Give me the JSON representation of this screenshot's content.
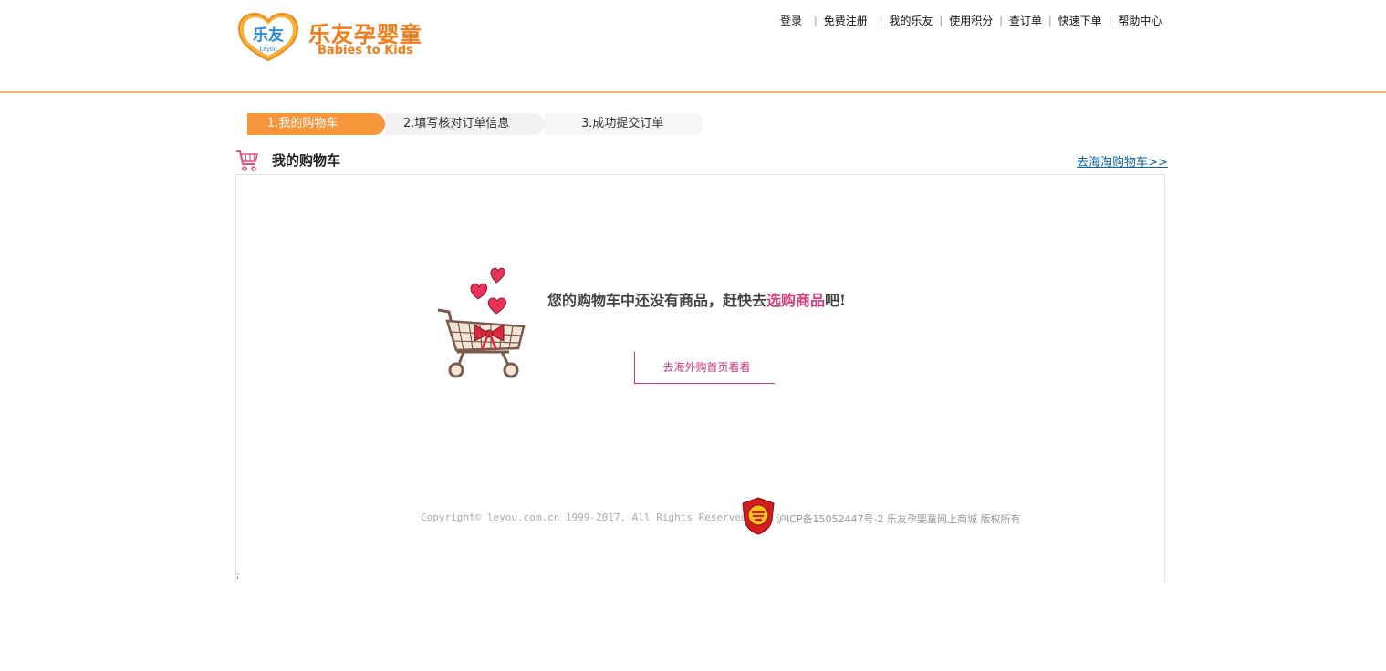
{
  "header": {
    "logo_cn": "乐友孕婴童",
    "logo_en": "Babies to Kids",
    "logo_badge": "乐友",
    "logo_badge_sub": "Leyou",
    "nav": [
      "登录",
      "免费注册",
      "我的乐友",
      "使用积分",
      "查订单",
      "快速下单",
      "帮助中心"
    ],
    "accent_color": "#f07d1a"
  },
  "steps": [
    {
      "label": "1.我的购物车",
      "active": true
    },
    {
      "label": "2.填写核对订单信息",
      "active": false
    },
    {
      "label": "3.成功提交订单",
      "active": false
    }
  ],
  "cart": {
    "title": "我的购物车",
    "haitao_link": "去海淘购物车>>",
    "icon": "shopping-cart-icon"
  },
  "empty": {
    "message_before": "您的购物车中还没有商品，赶快去",
    "message_highlight": "选购商品",
    "message_after": "吧!",
    "button_label": "去海外购首页看看",
    "highlight_color": "#d43d7a"
  },
  "footer": {
    "copyright": "Copyright© leyou.com.cn 1999-2017, All Rights Reserved",
    "icp": "沪ICP备15052447号-2 乐友孕婴童网上商城 版权所有",
    "stray_char": ";"
  }
}
